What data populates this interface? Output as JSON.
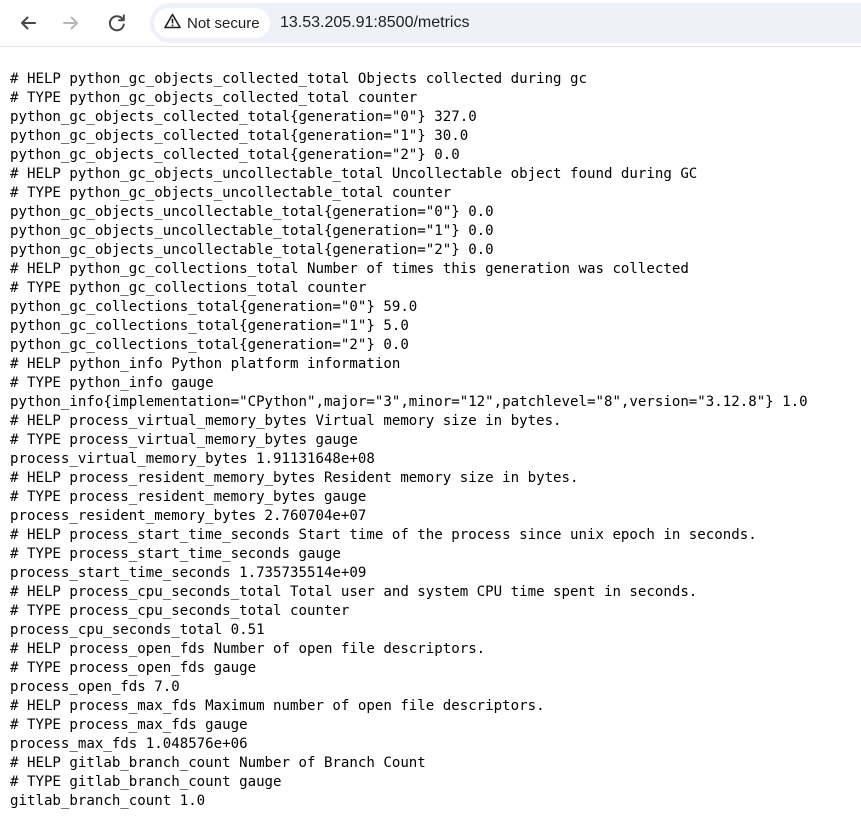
{
  "browser": {
    "security_label": "Not secure",
    "url": "13.53.205.91:8500/metrics",
    "icons": [
      "back-arrow-icon",
      "forward-arrow-icon",
      "reload-icon",
      "warning-triangle-icon"
    ]
  },
  "metrics_lines": [
    "# HELP python_gc_objects_collected_total Objects collected during gc",
    "# TYPE python_gc_objects_collected_total counter",
    "python_gc_objects_collected_total{generation=\"0\"} 327.0",
    "python_gc_objects_collected_total{generation=\"1\"} 30.0",
    "python_gc_objects_collected_total{generation=\"2\"} 0.0",
    "# HELP python_gc_objects_uncollectable_total Uncollectable object found during GC",
    "# TYPE python_gc_objects_uncollectable_total counter",
    "python_gc_objects_uncollectable_total{generation=\"0\"} 0.0",
    "python_gc_objects_uncollectable_total{generation=\"1\"} 0.0",
    "python_gc_objects_uncollectable_total{generation=\"2\"} 0.0",
    "# HELP python_gc_collections_total Number of times this generation was collected",
    "# TYPE python_gc_collections_total counter",
    "python_gc_collections_total{generation=\"0\"} 59.0",
    "python_gc_collections_total{generation=\"1\"} 5.0",
    "python_gc_collections_total{generation=\"2\"} 0.0",
    "# HELP python_info Python platform information",
    "# TYPE python_info gauge",
    "python_info{implementation=\"CPython\",major=\"3\",minor=\"12\",patchlevel=\"8\",version=\"3.12.8\"} 1.0",
    "# HELP process_virtual_memory_bytes Virtual memory size in bytes.",
    "# TYPE process_virtual_memory_bytes gauge",
    "process_virtual_memory_bytes 1.91131648e+08",
    "# HELP process_resident_memory_bytes Resident memory size in bytes.",
    "# TYPE process_resident_memory_bytes gauge",
    "process_resident_memory_bytes 2.760704e+07",
    "# HELP process_start_time_seconds Start time of the process since unix epoch in seconds.",
    "# TYPE process_start_time_seconds gauge",
    "process_start_time_seconds 1.735735514e+09",
    "# HELP process_cpu_seconds_total Total user and system CPU time spent in seconds.",
    "# TYPE process_cpu_seconds_total counter",
    "process_cpu_seconds_total 0.51",
    "# HELP process_open_fds Number of open file descriptors.",
    "# TYPE process_open_fds gauge",
    "process_open_fds 7.0",
    "# HELP process_max_fds Maximum number of open file descriptors.",
    "# TYPE process_max_fds gauge",
    "process_max_fds 1.048576e+06",
    "# HELP gitlab_branch_count Number of Branch Count",
    "# TYPE gitlab_branch_count gauge",
    "gitlab_branch_count 1.0"
  ]
}
